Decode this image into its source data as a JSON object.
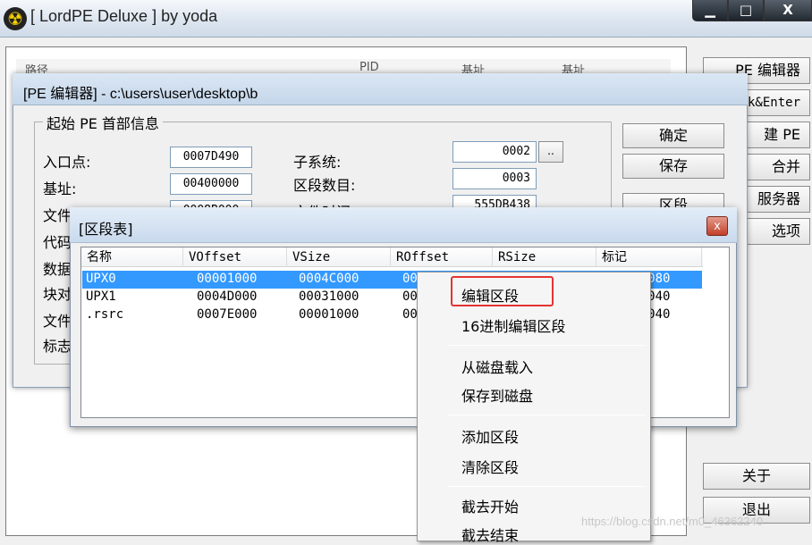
{
  "main_window": {
    "title": "[ LordPE Deluxe ] by yoda",
    "logo": "radiation-icon",
    "controls": {
      "minimize": "▁",
      "maximize": "□",
      "close": "X"
    },
    "list_header": [
      "路径",
      "PID",
      "基址",
      "基址"
    ]
  },
  "side_buttons": {
    "pe_editor": "PE 编辑器",
    "shortcut": "Break&Enter",
    "rebuild": "建 PE",
    "merge": "合并",
    "server": "服务器",
    "options": "选项",
    "about": "关于",
    "exit": "退出"
  },
  "pe_editor": {
    "title": "[PE 编辑器] - c:\\users\\user\\desktop\\b",
    "group_label": "起始 PE 首部信息",
    "fields": {
      "entry_point": {
        "label": "入口点:",
        "value": "0007D490"
      },
      "image_base": {
        "label": "基址:",
        "value": "00400000"
      },
      "size_of_image": {
        "label": "文件大小:",
        "value": "0008B000"
      },
      "row4_label": "代码",
      "row5_label": "数据",
      "row6_label": "块对",
      "row7_label": "文件",
      "row8_label": "标志",
      "subsystem": {
        "label": "子系统:",
        "value": "0002"
      },
      "section_count": {
        "label": "区段数目:",
        "value": "0003"
      },
      "timestamp": {
        "label": "文件时间:",
        "value": "555DB438"
      }
    },
    "small_button": "..",
    "buttons": {
      "ok": "确定",
      "save": "保存",
      "sections": "区段"
    }
  },
  "section_table": {
    "title": "[区段表]",
    "close": "x",
    "columns": [
      "名称",
      "VOffset",
      "VSize",
      "ROffset",
      "RSize",
      "标记"
    ],
    "rows": [
      {
        "name": "UPX0",
        "voffset": "00001000",
        "vsize": "0004C000",
        "roffset": "00",
        "flags": "E0000080",
        "selected": true
      },
      {
        "name": "UPX1",
        "voffset": "0004D000",
        "vsize": "00031000",
        "roffset": "00",
        "flags": "E0000040"
      },
      {
        "name": ".rsrc",
        "voffset": "0007E000",
        "vsize": "00001000",
        "roffset": "00",
        "flags": "C0000040"
      }
    ]
  },
  "context_menu": {
    "items": [
      "编辑区段",
      "16进制编辑区段",
      "从磁盘载入",
      "保存到磁盘",
      "添加区段",
      "清除区段",
      "截去开始",
      "截去结束"
    ]
  },
  "watermark": "https://blog.csdn.net/m0_46362240",
  "colors": {
    "selection": "#3399ff",
    "highlight_border": "#e53333"
  }
}
